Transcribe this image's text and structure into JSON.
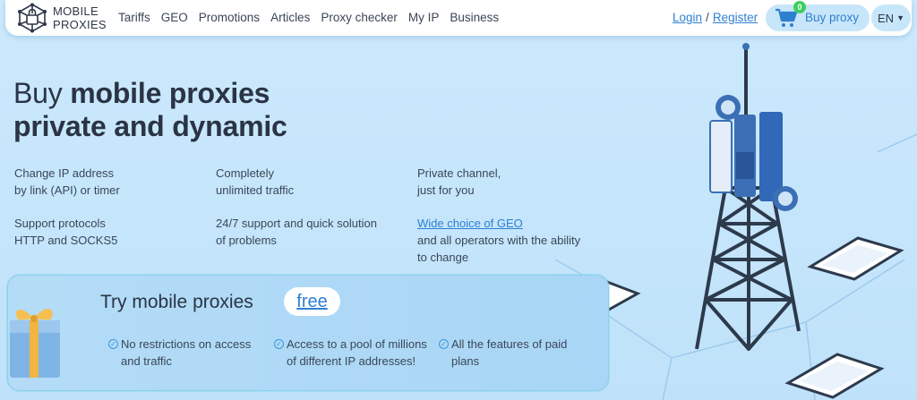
{
  "logo": {
    "line1": "MOBILE",
    "line2": "PROXIES"
  },
  "nav": [
    "Tariffs",
    "GEO",
    "Promotions",
    "Articles",
    "Proxy checker",
    "My IP",
    "Business"
  ],
  "auth": {
    "login": "Login",
    "separator": "/",
    "register": "Register"
  },
  "cart": {
    "count": "0",
    "buy_label": "Buy proxy"
  },
  "lang": {
    "current": "EN"
  },
  "hero": {
    "title_prefix": "Buy ",
    "title_bold": "mobile proxies",
    "title_line2": "private and dynamic"
  },
  "features": [
    {
      "line1": "Change IP address",
      "line2": "by link (API) or timer"
    },
    {
      "line1": "Completely",
      "line2": "unlimited traffic"
    },
    {
      "line1": "Private channel,",
      "line2": "just for you"
    },
    {
      "line1": "Support protocols",
      "line2": "HTTP and SOCKS5"
    },
    {
      "line1": "24/7 support and quick solution",
      "line2": "of problems"
    },
    {
      "link": "Wide choice of GEO",
      "line2": "and all operators with the ability",
      "line3": "to change"
    }
  ],
  "promo": {
    "title": "Try mobile proxies",
    "free": "free",
    "points": [
      {
        "line1": "No restrictions on access",
        "line2": "and traffic"
      },
      {
        "line1": "Access to a pool of millions",
        "line2": "of different IP addresses!"
      },
      {
        "line1": "All the features of paid",
        "line2": "plans"
      }
    ]
  },
  "colors": {
    "accent": "#2f7fd1",
    "badge": "#3ccf62",
    "hero_bg": "#c5e6fb"
  }
}
